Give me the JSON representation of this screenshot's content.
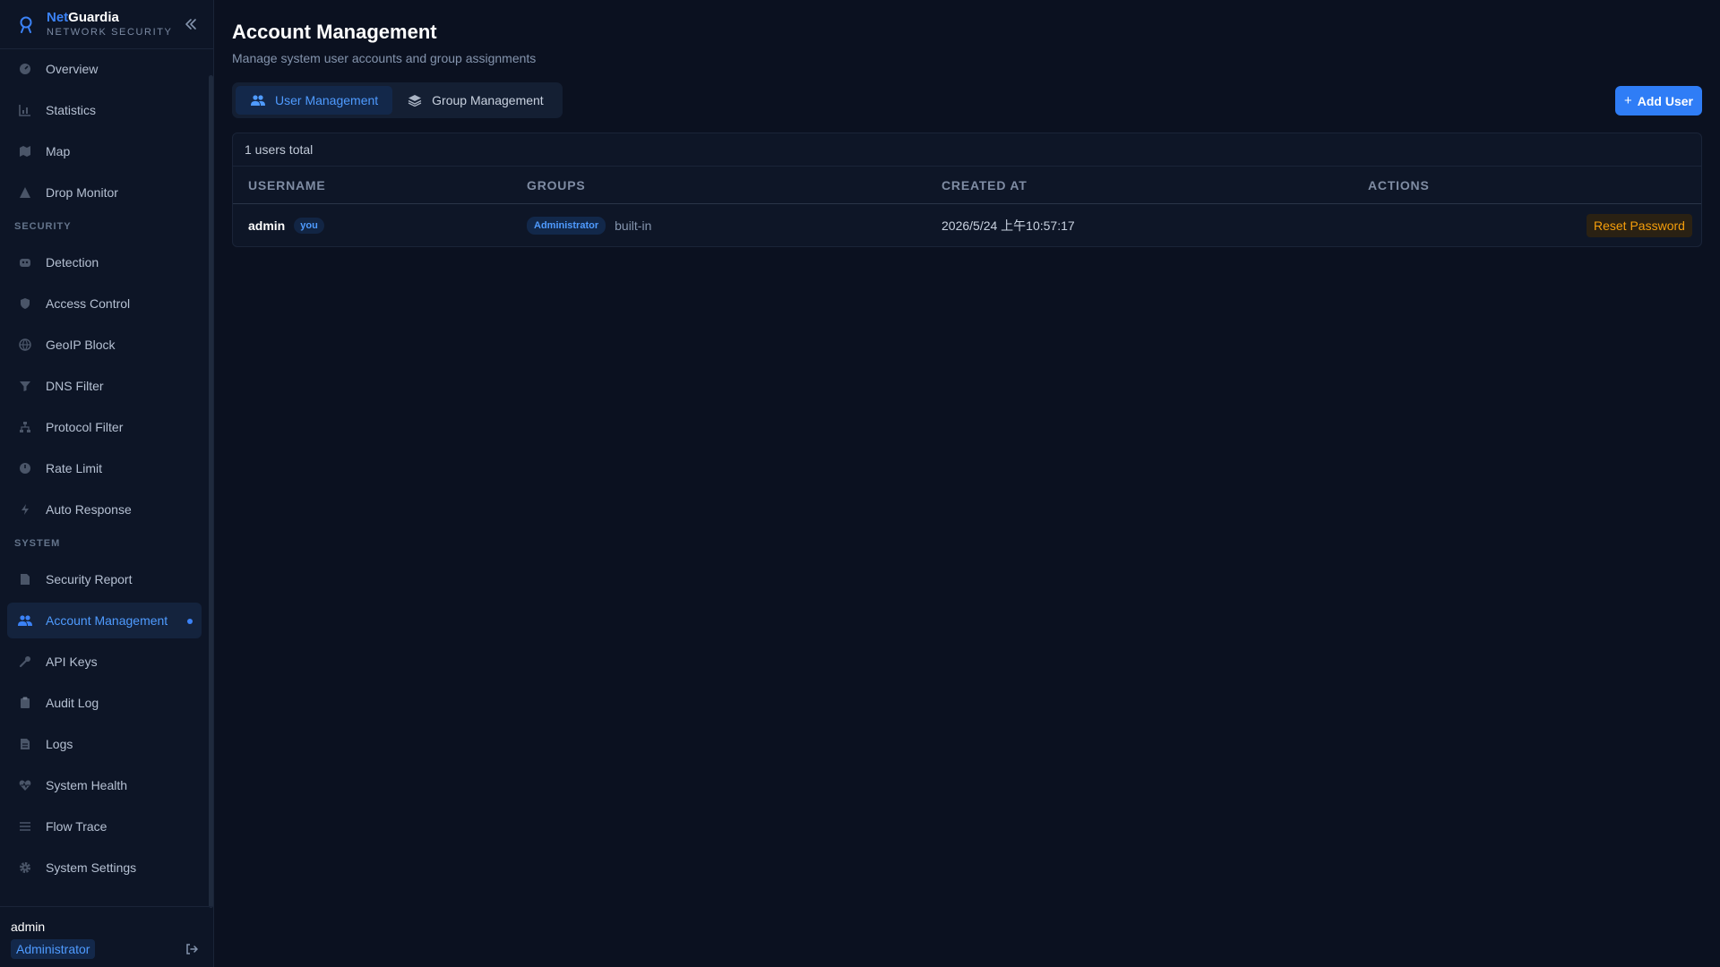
{
  "brand": {
    "name_part1": "Net",
    "name_part2": "Guardia",
    "subtitle": "NETWORK SECURITY"
  },
  "nav": {
    "main_items": [
      {
        "label": "Overview",
        "icon": "gauge-icon"
      },
      {
        "label": "Statistics",
        "icon": "bar-chart-icon"
      },
      {
        "label": "Map",
        "icon": "map-icon"
      },
      {
        "label": "Drop Monitor",
        "icon": "warning-icon"
      }
    ],
    "security_label": "SECURITY",
    "security_items": [
      {
        "label": "Detection",
        "icon": "robot-icon"
      },
      {
        "label": "Access Control",
        "icon": "shield-icon"
      },
      {
        "label": "GeoIP Block",
        "icon": "globe-icon"
      },
      {
        "label": "DNS Filter",
        "icon": "filter-icon"
      },
      {
        "label": "Protocol Filter",
        "icon": "network-icon"
      },
      {
        "label": "Rate Limit",
        "icon": "speedometer-icon"
      },
      {
        "label": "Auto Response",
        "icon": "bolt-icon"
      }
    ],
    "system_label": "SYSTEM",
    "system_items": [
      {
        "label": "Security Report",
        "icon": "document-icon"
      },
      {
        "label": "Account Management",
        "icon": "users-icon",
        "active": true
      },
      {
        "label": "API Keys",
        "icon": "key-icon"
      },
      {
        "label": "Audit Log",
        "icon": "clipboard-icon"
      },
      {
        "label": "Logs",
        "icon": "file-icon"
      },
      {
        "label": "System Health",
        "icon": "heart-pulse-icon"
      },
      {
        "label": "Flow Trace",
        "icon": "list-icon"
      },
      {
        "label": "System Settings",
        "icon": "gear-icon"
      }
    ]
  },
  "current_user": {
    "name": "admin",
    "role": "Administrator"
  },
  "page": {
    "title": "Account Management",
    "subtitle": "Manage system user accounts and group assignments",
    "tabs": [
      {
        "label": "User Management",
        "active": true
      },
      {
        "label": "Group Management",
        "active": false
      }
    ],
    "add_button": "Add User"
  },
  "table": {
    "count_text": "1 users total",
    "headers": {
      "username": "USERNAME",
      "groups": "GROUPS",
      "created_at": "CREATED AT",
      "actions": "ACTIONS"
    },
    "rows": [
      {
        "username": "admin",
        "you_badge": "you",
        "group": "Administrator",
        "group_note": "built-in",
        "created_at": "2026/5/24 上午10:57:17",
        "action": "Reset Password"
      }
    ]
  },
  "colors": {
    "accent": "#2f7df6",
    "active_text": "#4f9bff",
    "warning": "#f59e0b",
    "background": "#0b1120"
  }
}
